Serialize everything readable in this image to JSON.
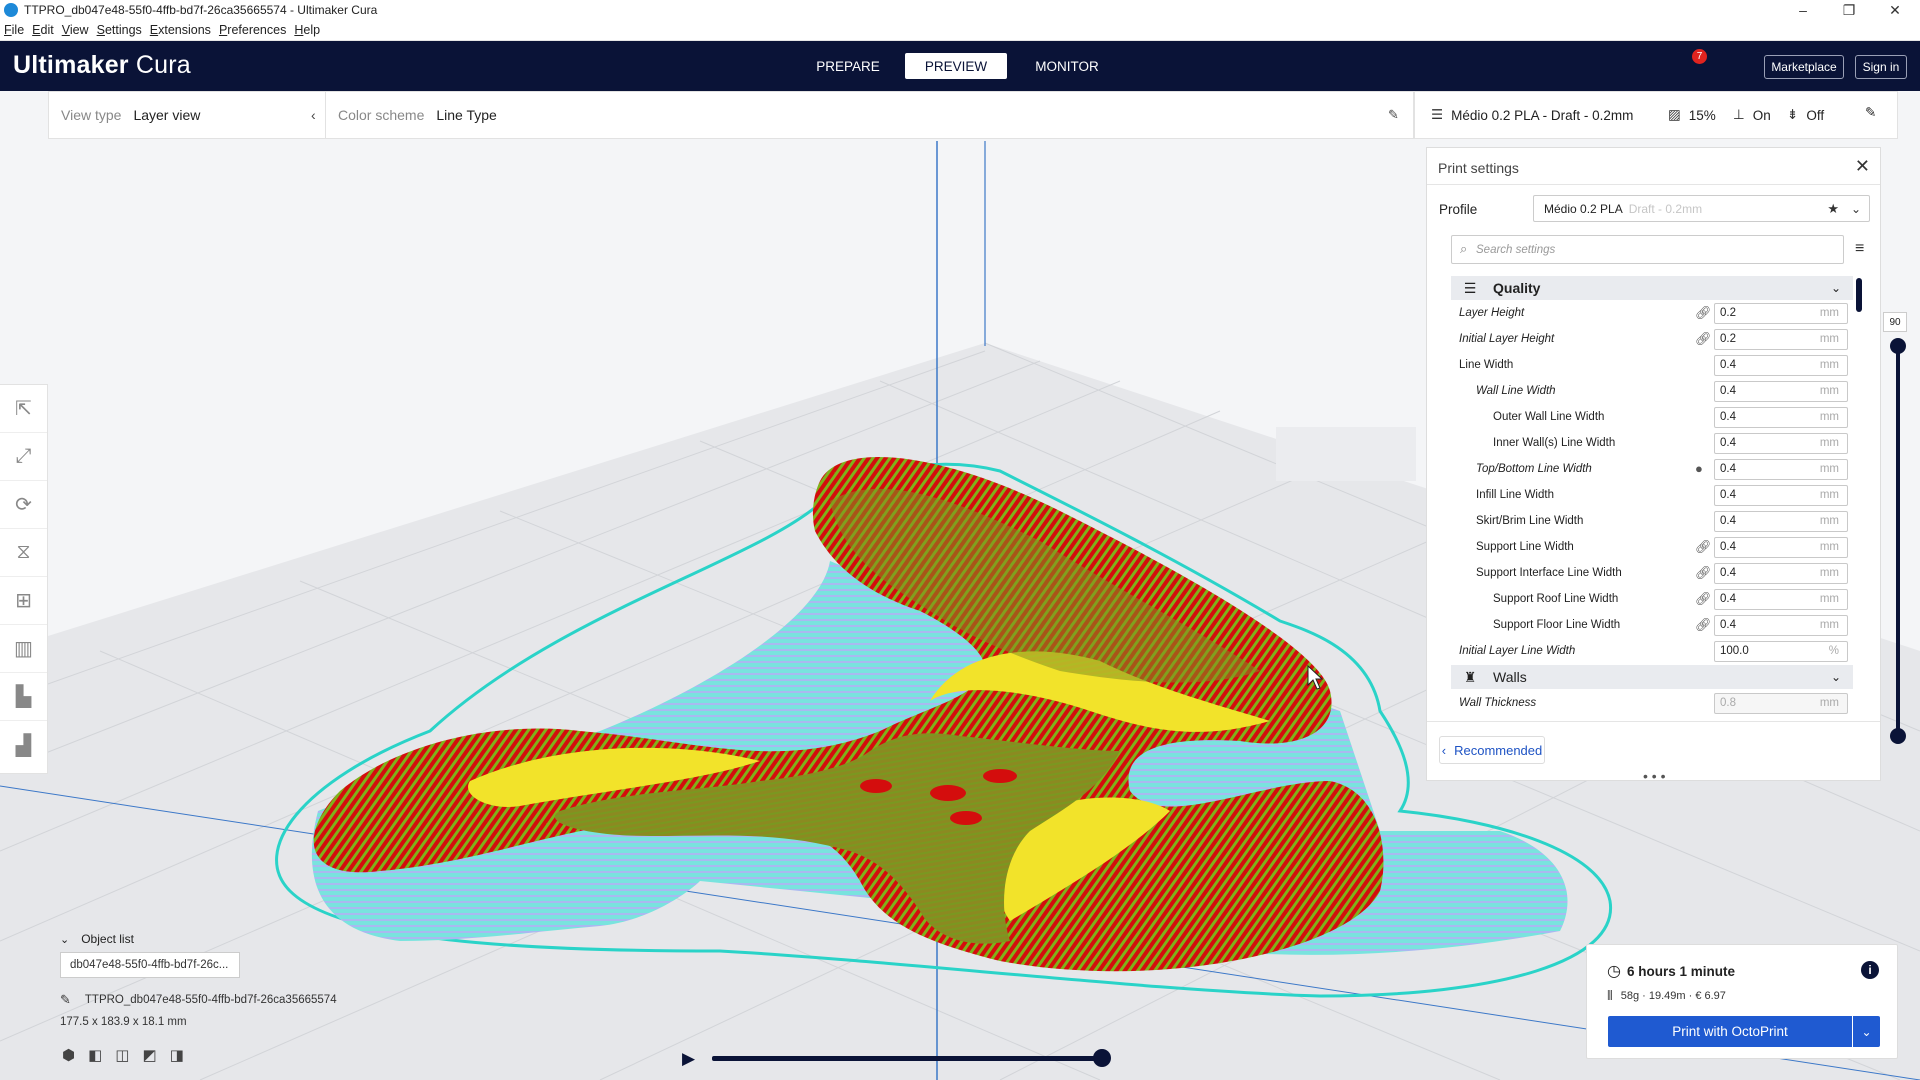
{
  "window": {
    "title": "TTPRO_db047e48-55f0-4ffb-bd7f-26ca35665574 - Ultimaker Cura",
    "minimize_glyph": "–",
    "maximize_glyph": "❐",
    "close_glyph": "✕"
  },
  "menu": {
    "file": "File",
    "edit": "Edit",
    "view": "View",
    "settings": "Settings",
    "extensions": "Extensions",
    "preferences": "Preferences",
    "help": "Help"
  },
  "header": {
    "logo_bold": "Ultimaker",
    "logo_light": "Cura",
    "stages": {
      "prepare": "PREPARE",
      "preview": "PREVIEW",
      "monitor": "MONITOR"
    },
    "active_stage": "PREVIEW",
    "marketplace": "Marketplace",
    "marketplace_badge": "7",
    "sign_in": "Sign in"
  },
  "viewbar": {
    "view_type_label": "View type",
    "view_type_value": "Layer view",
    "color_scheme_label": "Color scheme",
    "color_scheme_value": "Line Type"
  },
  "quick_settings": {
    "profile": "Médio 0.2 PLA - Draft - 0.2mm",
    "infill": "15%",
    "support": "On",
    "adhesion": "Off"
  },
  "print_settings": {
    "title": "Print settings",
    "profile_label": "Profile",
    "profile_name": "Médio 0.2 PLA",
    "profile_suffix": "Draft - 0.2mm",
    "search_placeholder": "Search settings",
    "categories": {
      "quality": "Quality",
      "walls": "Walls"
    },
    "rows": [
      {
        "label": "Layer Height",
        "value": "0.2",
        "unit": "mm"
      },
      {
        "label": "Initial Layer Height",
        "value": "0.2",
        "unit": "mm"
      },
      {
        "label": "Line Width",
        "value": "0.4",
        "unit": "mm"
      },
      {
        "label": "Wall Line Width",
        "value": "0.4",
        "unit": "mm"
      },
      {
        "label": "Outer Wall Line Width",
        "value": "0.4",
        "unit": "mm"
      },
      {
        "label": "Inner Wall(s) Line Width",
        "value": "0.4",
        "unit": "mm"
      },
      {
        "label": "Top/Bottom Line Width",
        "value": "0.4",
        "unit": "mm"
      },
      {
        "label": "Infill Line Width",
        "value": "0.4",
        "unit": "mm"
      },
      {
        "label": "Skirt/Brim Line Width",
        "value": "0.4",
        "unit": "mm"
      },
      {
        "label": "Support Line Width",
        "value": "0.4",
        "unit": "mm"
      },
      {
        "label": "Support Interface Line Width",
        "value": "0.4",
        "unit": "mm"
      },
      {
        "label": "Support Roof Line Width",
        "value": "0.4",
        "unit": "mm"
      },
      {
        "label": "Support Floor Line Width",
        "value": "0.4",
        "unit": "mm"
      },
      {
        "label": "Initial Layer Line Width",
        "value": "100.0",
        "unit": "%"
      },
      {
        "label": "Wall Thickness",
        "value": "0.8",
        "unit": "mm"
      }
    ],
    "recommended": "Recommended",
    "resize_handle": "• • •"
  },
  "layer_slider": {
    "value": "90"
  },
  "object_list": {
    "header": "Object list",
    "item": "db047e48-55f0-4ffb-bd7f-26c...",
    "object_name": "TTPRO_db047e48-55f0-4ffb-bd7f-26ca35665574",
    "dimensions": "177.5 x 183.9 x 18.1 mm"
  },
  "print_job": {
    "time": "6 hours 1 minute",
    "material": "58g · 19.49m · € 6.97",
    "print_button": "Print with OctoPrint"
  },
  "colors": {
    "header_bg": "#0a1337",
    "accent_blue": "#1f5ad1",
    "wall_red": "#d40d0d",
    "infill_yellow": "#f2e32a",
    "skin_olive": "#8b8a21",
    "support_cyan": "#72e0dc",
    "grid_blue": "#3c78c8"
  }
}
